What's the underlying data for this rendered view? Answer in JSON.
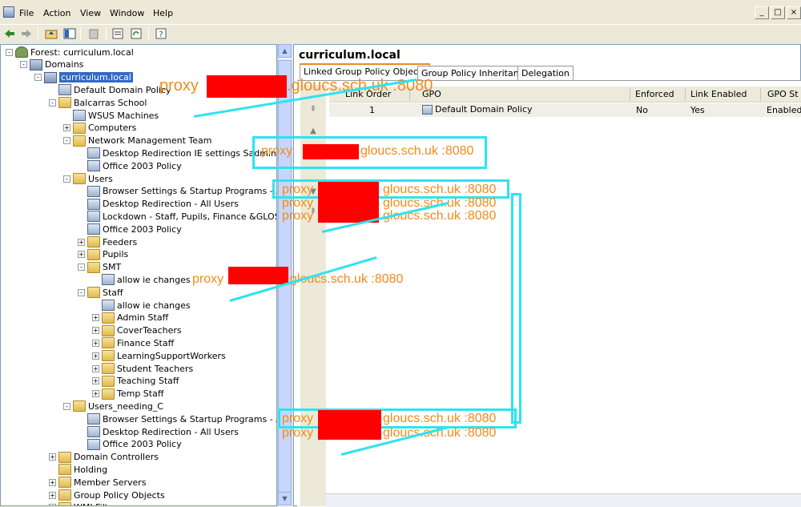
{
  "menu": {
    "items": [
      "File",
      "Action",
      "View",
      "Window",
      "Help"
    ]
  },
  "window_controls": [
    "_",
    "□",
    "×"
  ],
  "tree": {
    "rows": [
      {
        "label": "Forest: curriculum.local",
        "icon": "forest"
      },
      {
        "label": "Domains",
        "icon": "domain"
      },
      {
        "label": "curriculum.local",
        "icon": "domain",
        "selected": true
      },
      {
        "label": "Default Domain Policy",
        "icon": "gpo"
      },
      {
        "label": "Balcarras School",
        "icon": "folder"
      },
      {
        "label": "WSUS Machines",
        "icon": "gpo"
      },
      {
        "label": "Computers",
        "icon": "folder"
      },
      {
        "label": "Network Management Team",
        "icon": "folder"
      },
      {
        "label": "Desktop Redirection IE settings Sadmin",
        "icon": "gpo"
      },
      {
        "label": "Office 2003 Policy",
        "icon": "gpo"
      },
      {
        "label": "Users",
        "icon": "folder"
      },
      {
        "label": "Browser Settings & Startup Programs - All Us",
        "icon": "gpo"
      },
      {
        "label": "Desktop Redirection - All Users",
        "icon": "gpo"
      },
      {
        "label": "Lockdown - Staff, Pupils, Finance &GLOSCAT",
        "icon": "gpo"
      },
      {
        "label": "Office 2003 Policy",
        "icon": "gpo"
      },
      {
        "label": "Feeders",
        "icon": "folder"
      },
      {
        "label": "Pupils",
        "icon": "folder"
      },
      {
        "label": "SMT",
        "icon": "folder"
      },
      {
        "label": "allow ie changes",
        "icon": "gpo"
      },
      {
        "label": "Staff",
        "icon": "folder"
      },
      {
        "label": "allow ie changes",
        "icon": "gpo"
      },
      {
        "label": "Admin Staff",
        "icon": "folder"
      },
      {
        "label": "CoverTeachers",
        "icon": "folder"
      },
      {
        "label": "Finance Staff",
        "icon": "folder"
      },
      {
        "label": "LearningSupportWorkers",
        "icon": "folder"
      },
      {
        "label": "Student Teachers",
        "icon": "folder"
      },
      {
        "label": "Teaching Staff",
        "icon": "folder"
      },
      {
        "label": "Temp Staff",
        "icon": "folder"
      },
      {
        "label": "Users_needing_C",
        "icon": "folder"
      },
      {
        "label": "Browser Settings & Startup Programs - All Us",
        "icon": "gpo"
      },
      {
        "label": "Desktop Redirection - All Users",
        "icon": "gpo"
      },
      {
        "label": "Office 2003 Policy",
        "icon": "gpo"
      },
      {
        "label": "Domain Controllers",
        "icon": "folder"
      },
      {
        "label": "Holding",
        "icon": "folder"
      },
      {
        "label": "Member Servers",
        "icon": "folder"
      },
      {
        "label": "Group Policy Objects",
        "icon": "folder"
      },
      {
        "label": "WMI Filt",
        "icon": "folder"
      }
    ]
  },
  "right": {
    "title": "curriculum.local",
    "tabs": [
      "Linked Group Policy Objects",
      "Group Policy Inheritance",
      "Delegation"
    ],
    "columns": [
      "Link Order",
      "GPO",
      "Enforced",
      "Link Enabled",
      "GPO St"
    ],
    "rows": [
      {
        "order": "1",
        "gpo": "Default Domain Policy",
        "enforced": "No",
        "link_enabled": "Yes",
        "status": "Enabled"
      }
    ]
  },
  "overlays": {
    "proxy_prefix": "proxy",
    "proxy_suffix": "gloucs.sch.uk :8080",
    "proxy_suffix_top": ".gloucs.sch.uk :8080"
  },
  "colors": {
    "overlay_text": "#f38a1a",
    "redaction": "#ff0000",
    "annotation": "#2de3f0",
    "selection": "#316ac5"
  }
}
